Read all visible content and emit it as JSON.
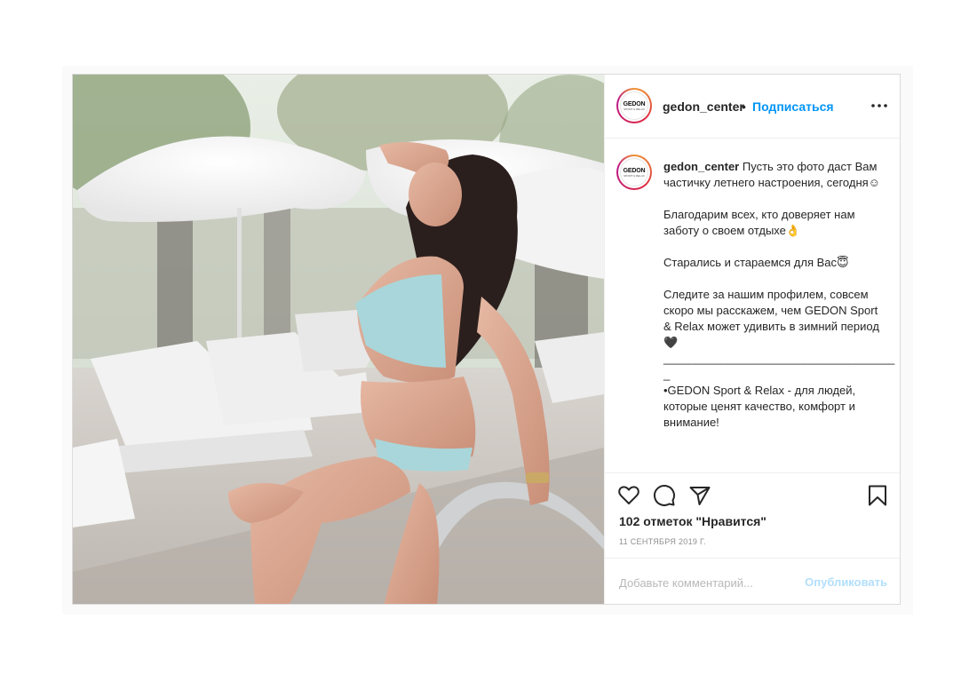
{
  "post": {
    "username": "gedon_center",
    "separator": "•",
    "follow_label": "Подписаться",
    "more_icon": "more-horizontal-icon",
    "avatar_brand": "GEDON",
    "avatar_brand_sub": "SPORT & RELAX",
    "caption": "Пусть это фото даст Вам частичку летнего настроения, сегодня☺\n\nБлагодарим всех, кто доверяет нам заботу о своем отдыхе👌\n\nСтарались и стараемся для Вас😇\n\nСледите за нашим профилем, совсем скоро мы расскажем, чем GEDON Sport & Relax может удивить в зимний период🖤\n____________________________________\n_\n•GEDON Sport & Relax - для людей, которые ценят качество, комфорт и внимание!",
    "likes": "102 отметок \"Нравится\"",
    "date": "11 СЕНТЯБРЯ 2019 Г.",
    "comment_placeholder": "Добавьте комментарий...",
    "publish_label": "Опубликовать"
  },
  "icons": {
    "like": "heart-icon",
    "comment": "comment-bubble-icon",
    "share": "paper-plane-icon",
    "save": "bookmark-icon"
  },
  "colors": {
    "link_blue": "#0095f6",
    "publish_disabled": "#b2dffc",
    "text": "#262626",
    "muted": "#8e8e8e",
    "border": "#dbdbdb"
  }
}
